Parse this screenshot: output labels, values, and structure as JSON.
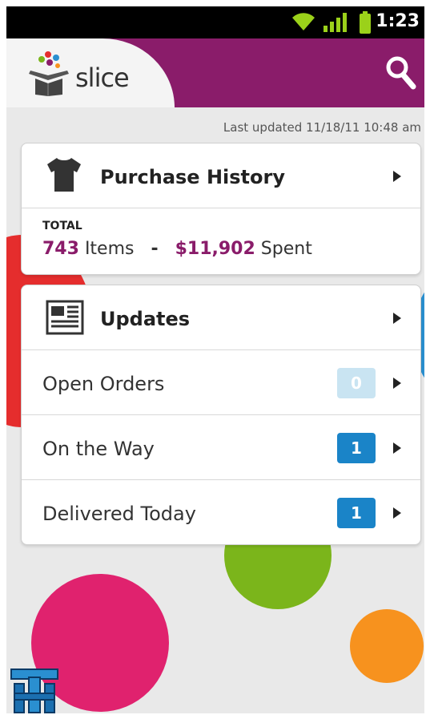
{
  "status_bar": {
    "time": "1:23"
  },
  "header": {
    "app_name": "slice"
  },
  "last_updated": "Last updated 11/18/11 10:48 am",
  "purchase_history": {
    "title": "Purchase History",
    "total_label": "TOTAL",
    "items_count": "743",
    "items_label": "Items",
    "separator": "-",
    "spent_amount": "$11,902",
    "spent_label": "Spent"
  },
  "updates": {
    "title": "Updates",
    "rows": [
      {
        "label": "Open Orders",
        "count": "0"
      },
      {
        "label": "On the Way",
        "count": "1"
      },
      {
        "label": "Delivered Today",
        "count": "1"
      }
    ]
  },
  "watermark": {
    "text": "TH"
  },
  "colors": {
    "brand_purple": "#8a1c6a",
    "badge_blue": "#1a84c8",
    "badge_blue_dim": "#c9e4f2",
    "circle_pink": "#e0226e",
    "circle_green": "#7bb51b",
    "circle_orange": "#f7921e",
    "circle_red": "#e52d2d",
    "circle_blue": "#2a8fd0"
  },
  "icons": {
    "search": "search-icon",
    "tshirt": "tshirt-icon",
    "newspaper": "newspaper-icon",
    "wifi": "wifi-icon",
    "signal": "signal-icon",
    "battery": "battery-icon",
    "chevron": "chevron-right-icon"
  }
}
